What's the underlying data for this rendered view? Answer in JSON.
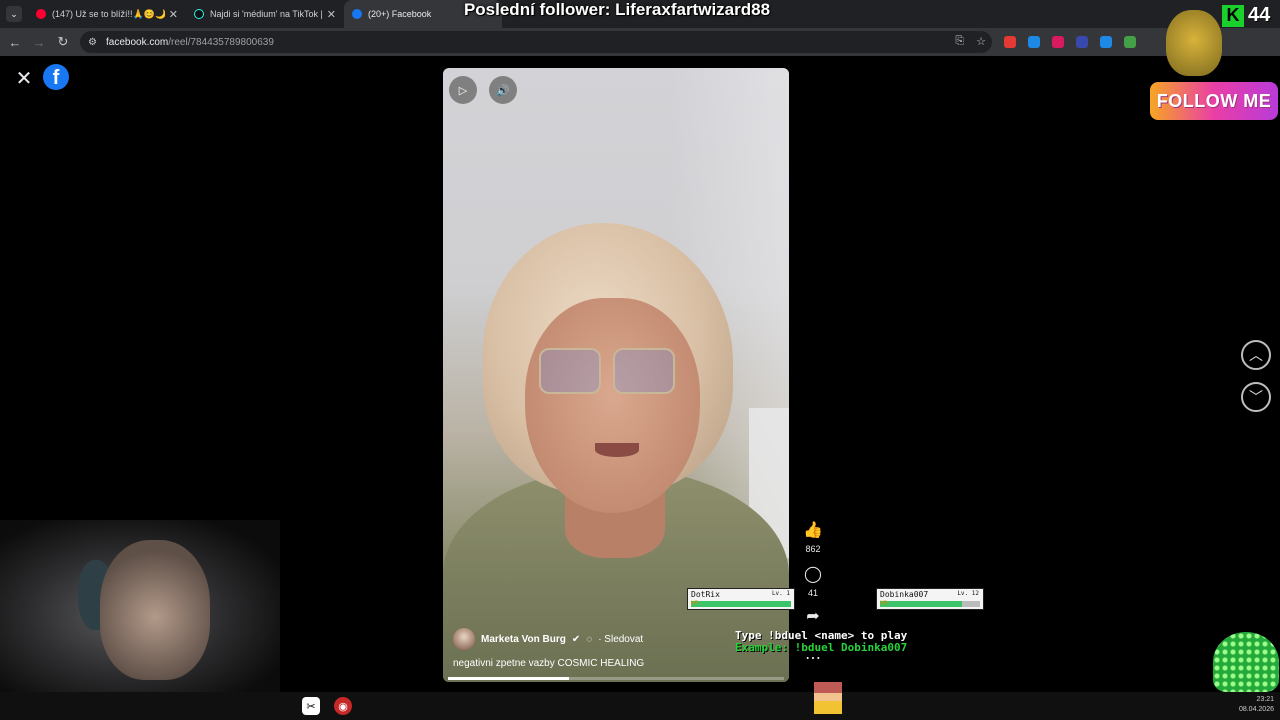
{
  "browser": {
    "tabs": [
      {
        "title": "(147) Už se to blíží!!🙏😊🌙 #co",
        "favicon": "youtube-icon",
        "color": "#ff0033"
      },
      {
        "title": "Najdi si 'médium' na TikTok | H",
        "favicon": "tiktok-icon",
        "color": "#111111"
      },
      {
        "title": "(20+) Facebook",
        "favicon": "facebook-icon",
        "color": "#1877f2"
      }
    ],
    "url": {
      "domain": "facebook.com",
      "path": "/reel/784435789800639"
    },
    "extensions": [
      "#e53935",
      "#1e88e5",
      "#d81b60",
      "#3949ab",
      "#1e88e5",
      "#43a047",
      "#00c853"
    ]
  },
  "overlay": {
    "headline": "Poslední follower: Liferaxfartwizard88",
    "follower_count": "44",
    "follow_label": "FOLLOW ME",
    "k_mark": "K"
  },
  "reel": {
    "author": "Marketa Von Burg",
    "follow_label": "· Sledovat",
    "caption": "negativni zpetne vazby COSMIC HEALING",
    "progress": 0.36,
    "likes": "862",
    "comments": "41"
  },
  "game": {
    "player1": {
      "name": "DotRix",
      "level": "Lv. 1",
      "hp": 1.0
    },
    "player2": {
      "name": "Dobinka007",
      "level": "Lv. 12",
      "hp": 0.82
    },
    "hp_tag": "HP:",
    "instruction": "Type !bduel <name> to play",
    "example": "Example: !bduel Dobinka007"
  },
  "taskbar": {
    "time": "23:21",
    "date": "08.04.2026"
  }
}
